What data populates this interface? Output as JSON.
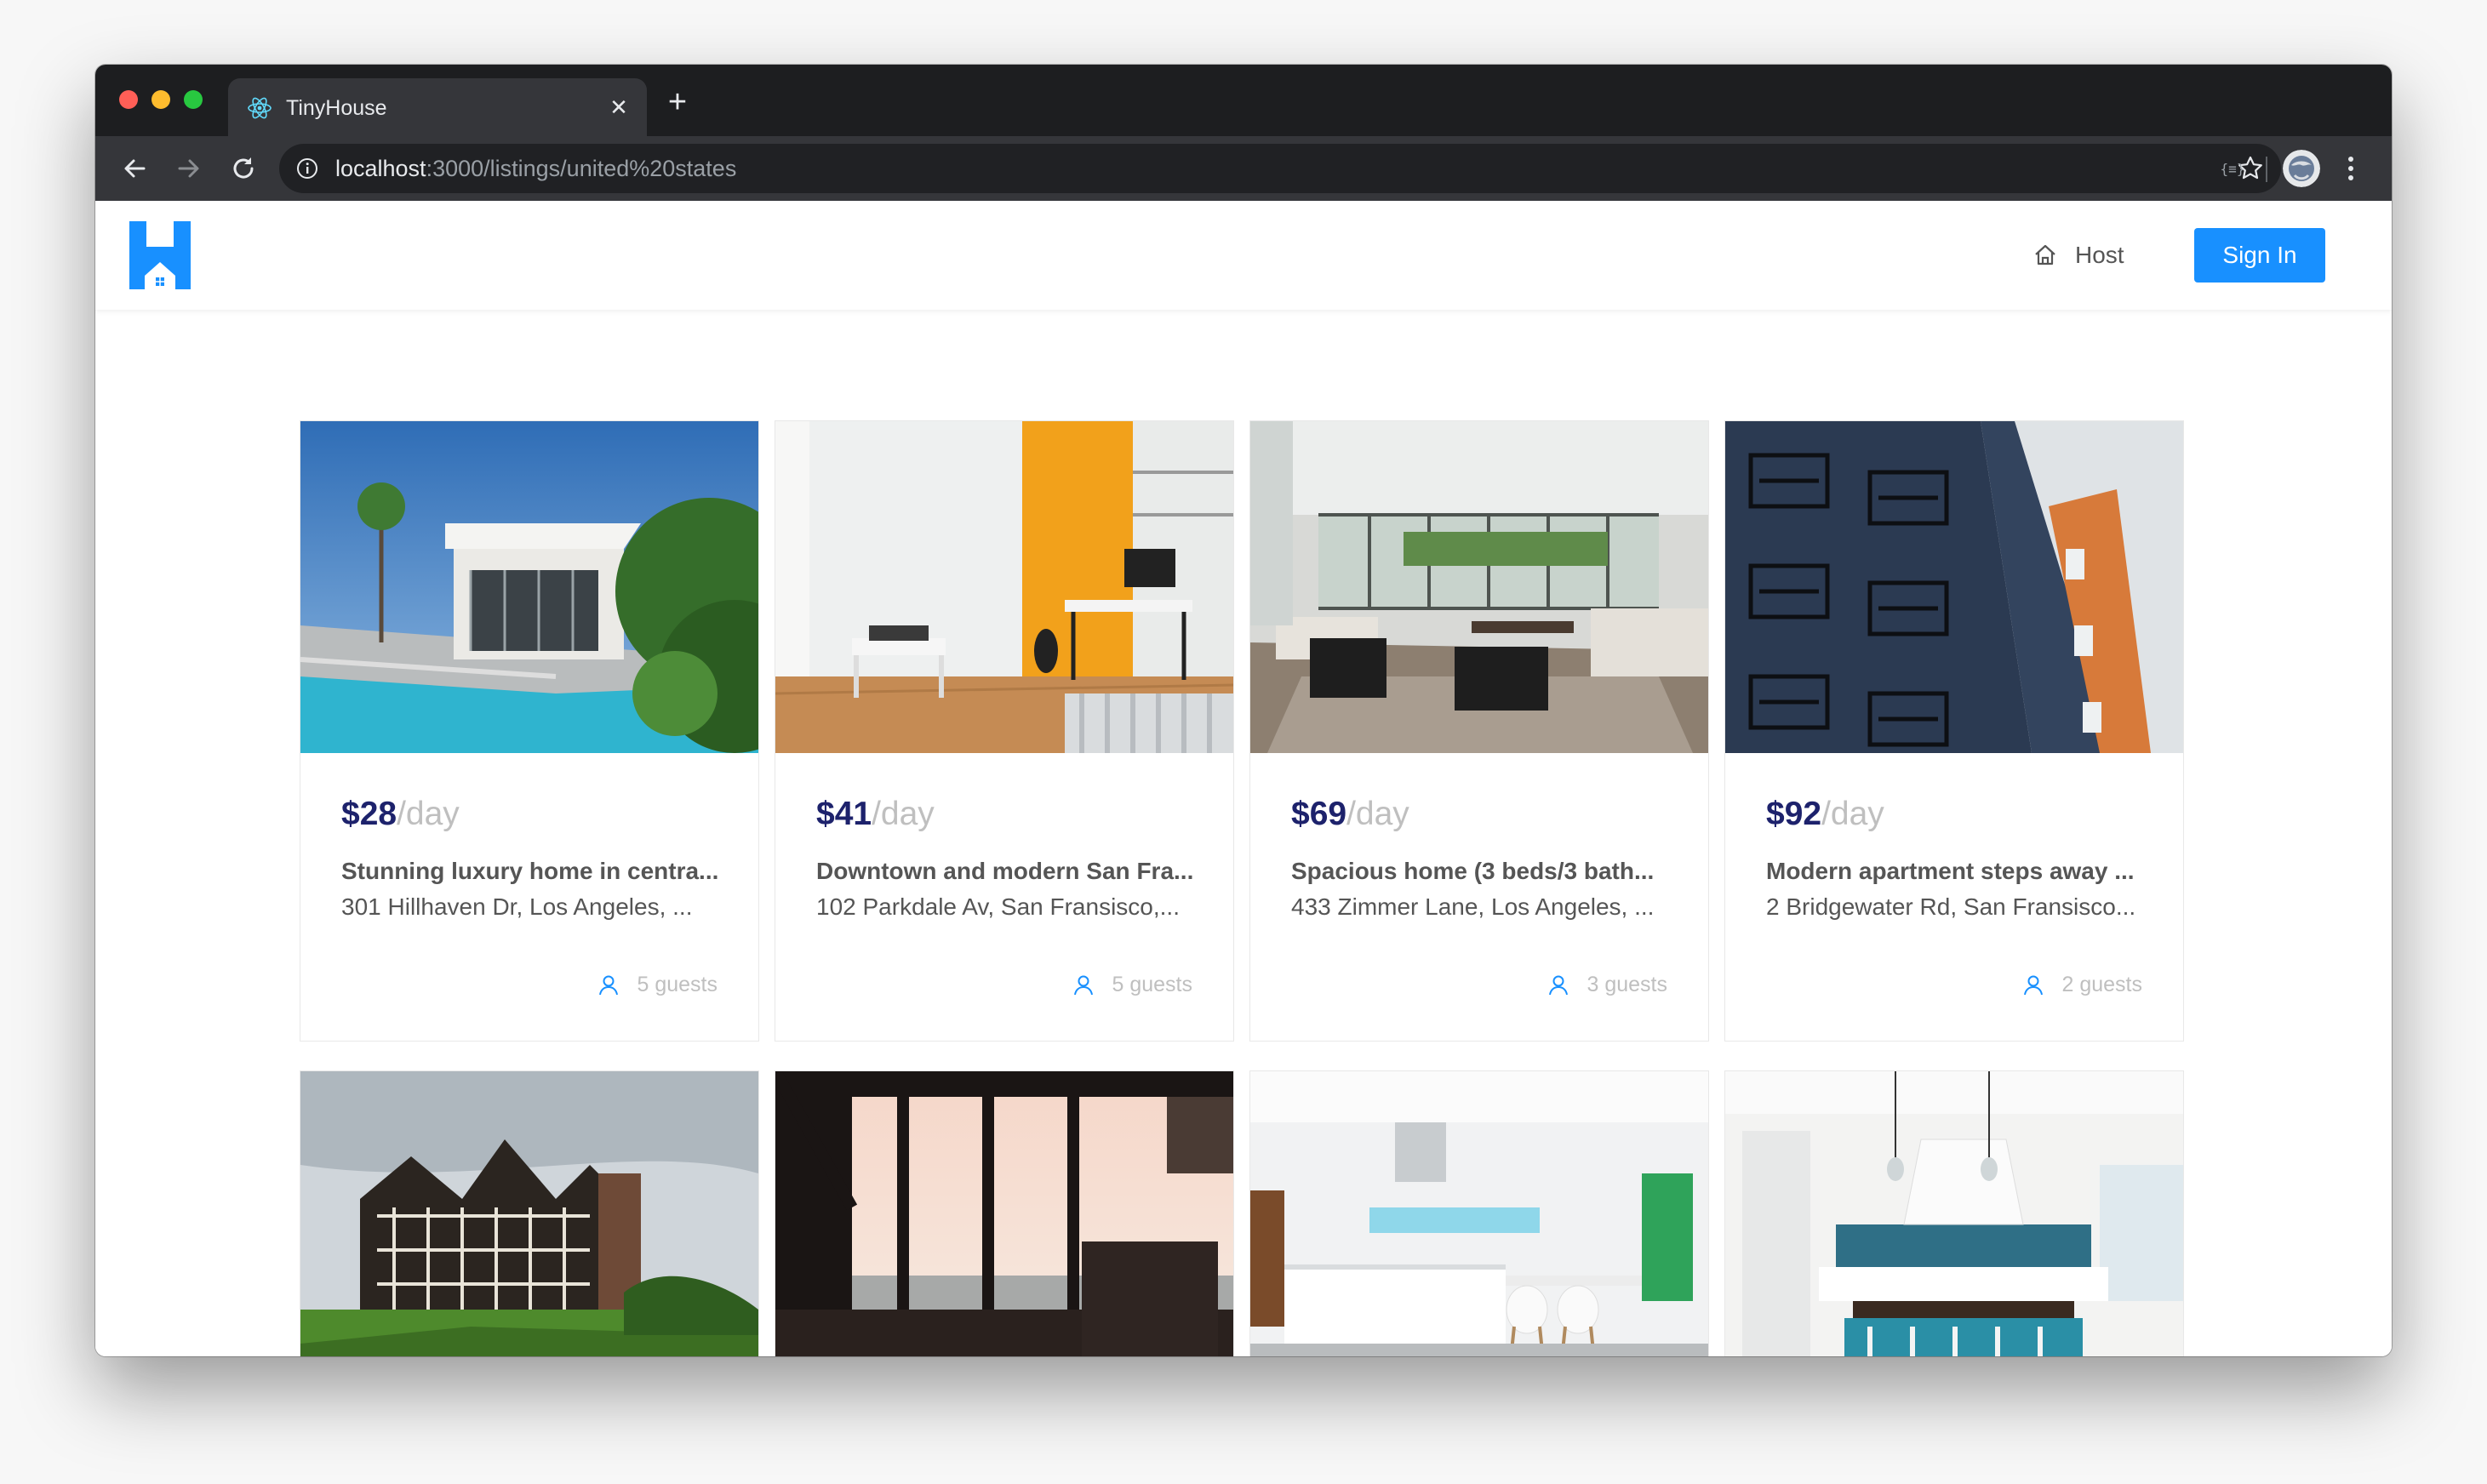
{
  "browser": {
    "tab_title": "TinyHouse",
    "tab_close": "✕",
    "new_tab": "+",
    "url_host": "localhost",
    "url_rest": ":3000/listings/united%20states",
    "ext_label": "{≡}"
  },
  "header": {
    "host_label": "Host",
    "signin_label": "Sign In"
  },
  "colors": {
    "accent": "#1890ff",
    "price": "#1d226c",
    "muted": "#bfbfbf"
  },
  "listings": [
    {
      "price": "$28",
      "unit": "/day",
      "title": "Stunning luxury home in centra...",
      "address": "301 Hillhaven Dr, Los Angeles, ...",
      "guests": "5 guests"
    },
    {
      "price": "$41",
      "unit": "/day",
      "title": "Downtown and modern San Fra...",
      "address": "102 Parkdale Av, San Fransisco,...",
      "guests": "5 guests"
    },
    {
      "price": "$69",
      "unit": "/day",
      "title": "Spacious home (3 beds/3 bath...",
      "address": "433 Zimmer Lane, Los Angeles, ...",
      "guests": "3 guests"
    },
    {
      "price": "$92",
      "unit": "/day",
      "title": "Modern apartment steps away ...",
      "address": "2 Bridgewater Rd, San Fransisco...",
      "guests": "2 guests"
    }
  ]
}
